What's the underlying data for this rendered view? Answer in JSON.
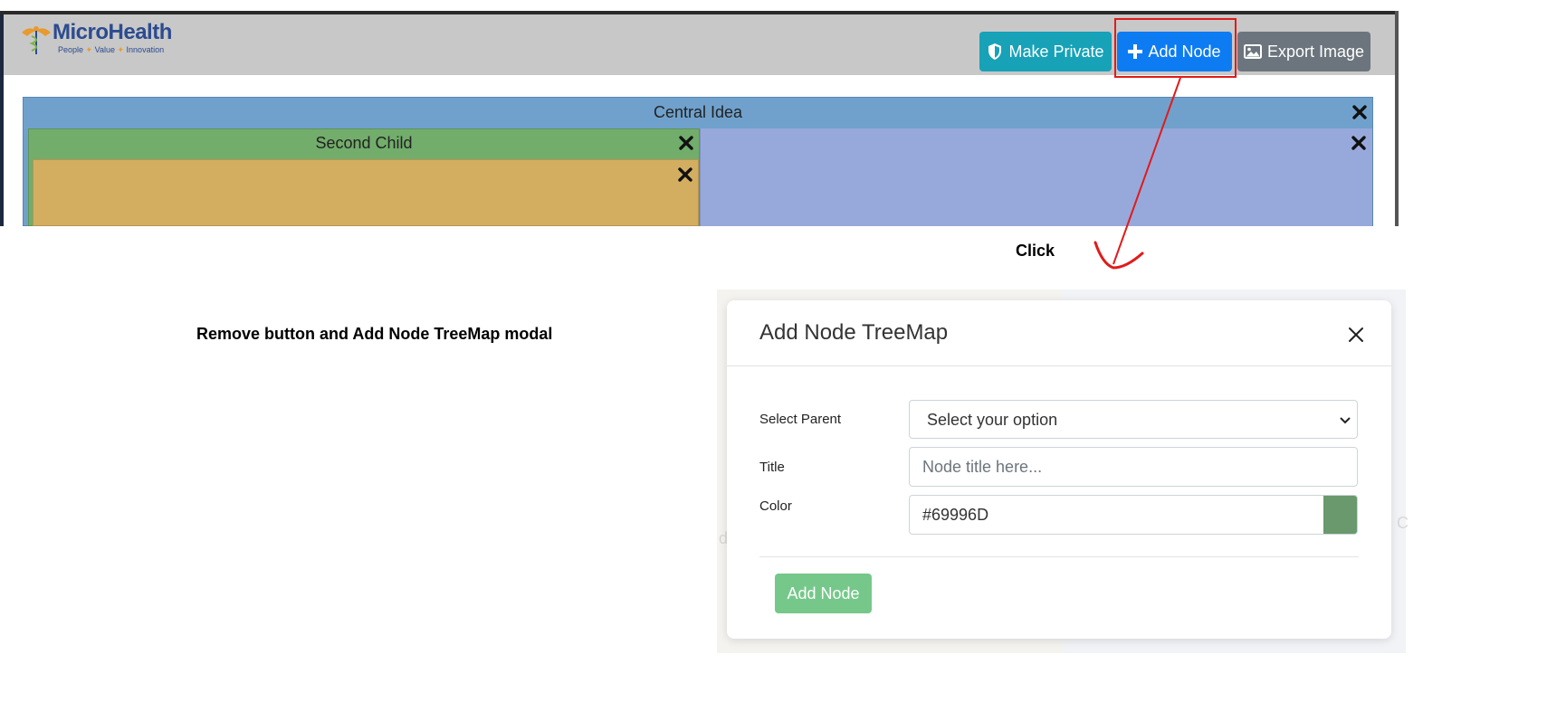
{
  "app": {
    "logo_name": "MicroHealth",
    "logo_tagline": [
      "People",
      "Value",
      "Innovation"
    ]
  },
  "toolbar": {
    "make_private_label": "Make Private",
    "add_node_label": "Add Node",
    "export_image_label": "Export Image"
  },
  "treemap": {
    "root_title": "Central Idea",
    "child_title": "Second Child",
    "colors": {
      "root": "#70a1cc",
      "child": "#72ad6b",
      "grandchild": "#d3ae61",
      "sibling": "#97a9db"
    }
  },
  "annotations": {
    "click_label": "Click",
    "caption": "Remove button and Add Node TreeMap modal",
    "highlight_color": "#e01b1b"
  },
  "modal": {
    "title": "Add Node TreeMap",
    "fields": {
      "parent_label": "Select Parent",
      "parent_value": "Select your option",
      "title_label": "Title",
      "title_placeholder": "Node title here...",
      "color_label": "Color",
      "color_value": "#69996D"
    },
    "submit_label": "Add Node"
  },
  "background_ghost": {
    "left_char": "d",
    "right_char": "C"
  }
}
